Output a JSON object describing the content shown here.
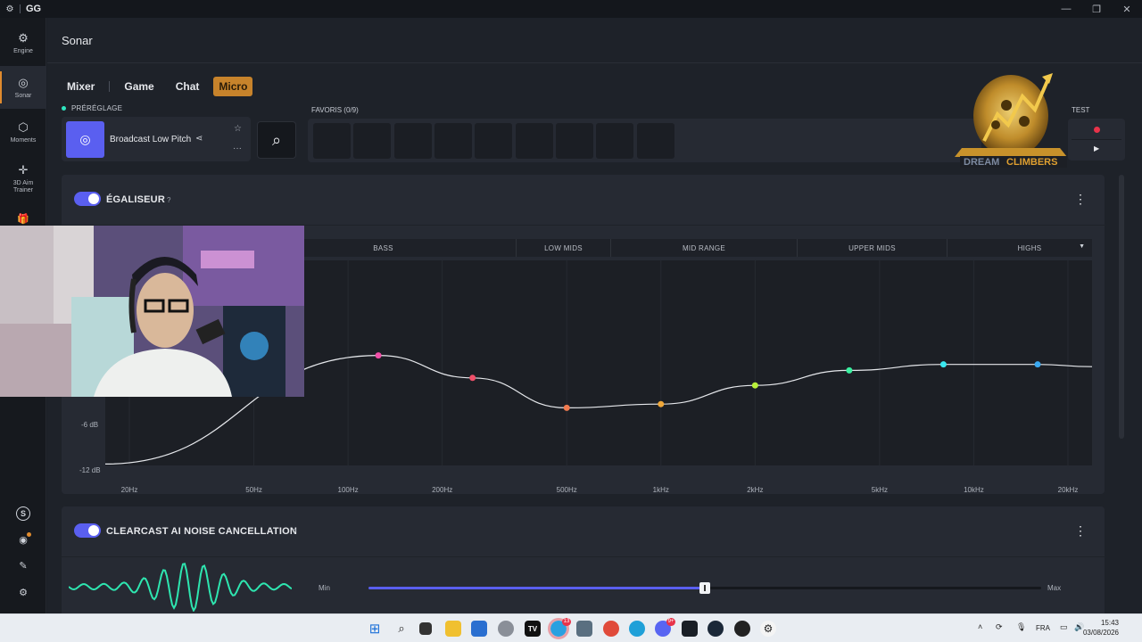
{
  "titlebar": {
    "app_name": "GG",
    "minimize": "—",
    "restore": "❐",
    "close": "✕"
  },
  "sidebar": {
    "items": [
      {
        "label": "Engine",
        "icon": "chip-icon",
        "glyph": "⚙"
      },
      {
        "label": "Sonar",
        "icon": "sonar-icon",
        "glyph": "◎"
      },
      {
        "label": "Moments",
        "icon": "hexagon-icon",
        "glyph": "⬡"
      },
      {
        "label": "3D Aim Trainer",
        "icon": "crosshair-icon",
        "glyph": "✛"
      },
      {
        "label": "",
        "icon": "gift-icon",
        "glyph": "🎁"
      }
    ],
    "bottom": [
      {
        "icon": "account-icon",
        "glyph": "S"
      },
      {
        "icon": "discord-icon",
        "glyph": "◉"
      },
      {
        "icon": "feedback-icon",
        "glyph": "✎"
      },
      {
        "icon": "settings-icon",
        "glyph": "⚙"
      }
    ]
  },
  "page": {
    "title": "Sonar"
  },
  "tabs": [
    {
      "label": "Mixer",
      "active": false
    },
    {
      "label": "Game",
      "active": false
    },
    {
      "label": "Chat",
      "active": false
    },
    {
      "label": "Micro",
      "active": true
    }
  ],
  "preset": {
    "section_label": "PRÉRÉGLAGE",
    "name": "Broadcast Low Pitch",
    "share_glyph": "⋖",
    "star_glyph": "☆",
    "more_glyph": "···"
  },
  "search": {
    "glyph": "⌕"
  },
  "favorites": {
    "label": "FAVORIS (0/9)",
    "slot_count": 9
  },
  "test": {
    "label": "TEST",
    "play_glyph": "▶"
  },
  "promo": {
    "text_left": "DREAM",
    "text_right": "CLIMBERS"
  },
  "equalizer": {
    "title": "ÉGALISEUR",
    "help": "?",
    "enabled": true,
    "bands": [
      "BASS",
      "LOW MIDS",
      "MID RANGE",
      "UPPER MIDS",
      "HIGHS"
    ],
    "dropdown_glyph": "▼",
    "db_labels": [
      "-6 dB",
      "-12 dB"
    ],
    "freq_labels": [
      "20Hz",
      "50Hz",
      "100Hz",
      "200Hz",
      "500Hz",
      "1kHz",
      "2kHz",
      "5kHz",
      "10kHz",
      "20kHz"
    ],
    "points": [
      {
        "freq": "25Hz",
        "gain_db": -12,
        "color": "#a64ff0"
      },
      {
        "freq": "125Hz",
        "gain_db": 3.5,
        "color": "#f04fa8"
      },
      {
        "freq": "250Hz",
        "gain_db": 0.5,
        "color": "#f0506a"
      },
      {
        "freq": "500Hz",
        "gain_db": -3.5,
        "color": "#f07a4f"
      },
      {
        "freq": "1kHz",
        "gain_db": -3,
        "color": "#f0a83a"
      },
      {
        "freq": "2kHz",
        "gain_db": -0.5,
        "color": "#b8f03a"
      },
      {
        "freq": "4kHz",
        "gain_db": 1.5,
        "color": "#3af0a0"
      },
      {
        "freq": "8kHz",
        "gain_db": 2.3,
        "color": "#3ae8f0"
      },
      {
        "freq": "16kHz",
        "gain_db": 2.3,
        "color": "#3aa8f0"
      }
    ]
  },
  "noise_cancel": {
    "title": "CLEARCAST AI NOISE CANCELLATION",
    "help": "?",
    "enabled": true,
    "min_label": "Min",
    "max_label": "Max",
    "level": 0.5
  },
  "taskbar": {
    "badges": {
      "telegram": "13",
      "discord": "9+"
    },
    "language": "FRA",
    "time": "15:43",
    "date": "03/08/2026"
  }
}
